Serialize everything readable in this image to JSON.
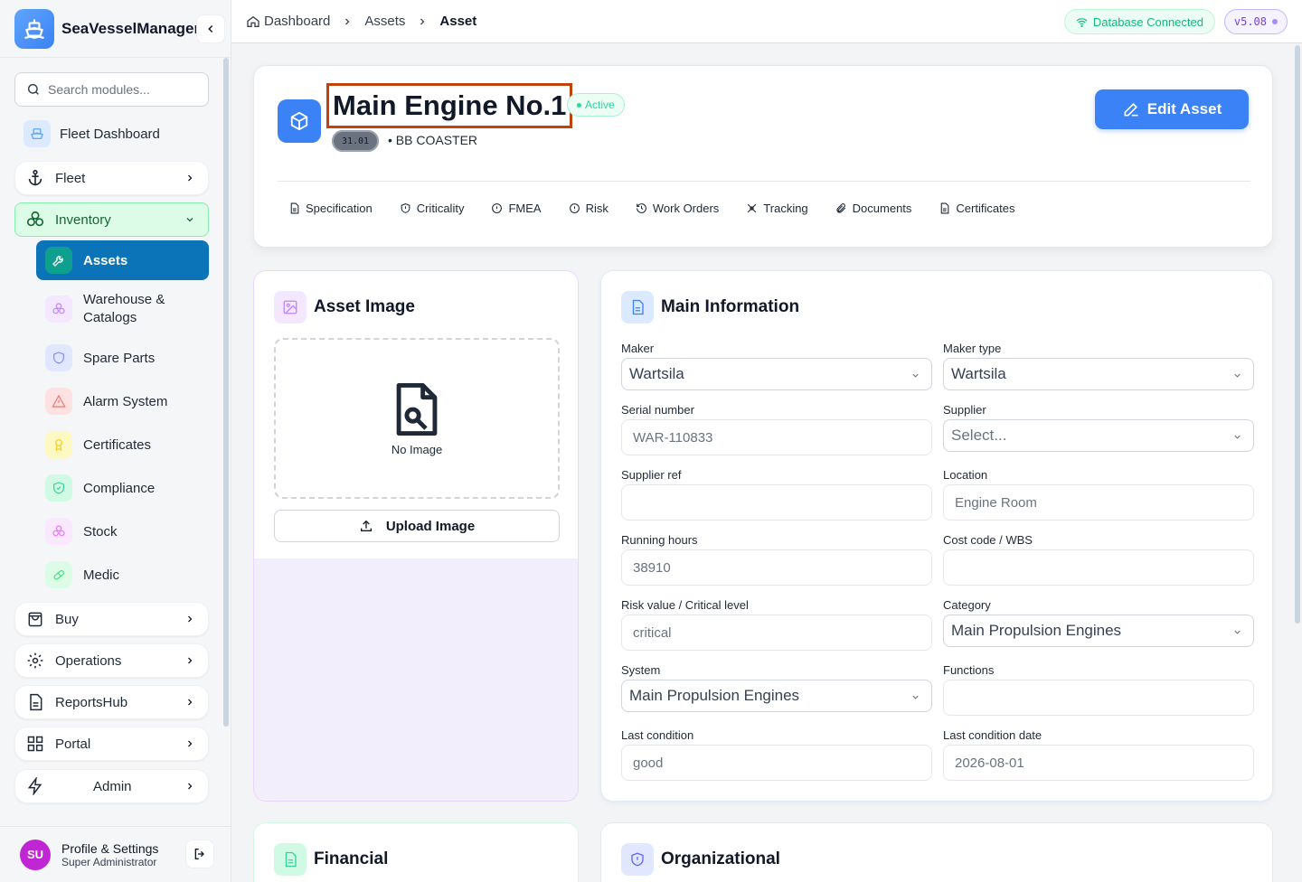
{
  "app": {
    "name": "SeaVesselManager",
    "search_placeholder": "Search modules..."
  },
  "sidebar": {
    "fleet_dashboard": "Fleet Dashboard",
    "fleet": "Fleet",
    "inventory": "Inventory",
    "inventory_items": [
      {
        "label": "Assets",
        "icon": "wrench-icon",
        "color": "#10b981"
      },
      {
        "label": "Warehouse & Catalogs",
        "icon": "boxes-icon",
        "color": "#c084fc"
      },
      {
        "label": "Spare Parts",
        "icon": "shield-icon",
        "color": "#818cf8"
      },
      {
        "label": "Alarm System",
        "icon": "warning-icon",
        "color": "#f87171"
      },
      {
        "label": "Certificates",
        "icon": "award-icon",
        "color": "#facc15"
      },
      {
        "label": "Compliance",
        "icon": "shield-check-icon",
        "color": "#34d399"
      },
      {
        "label": "Stock",
        "icon": "boxes-icon",
        "color": "#e879f9"
      },
      {
        "label": "Medic",
        "icon": "pill-icon",
        "color": "#4ade80"
      }
    ],
    "buy": "Buy",
    "operations": "Operations",
    "reports": "ReportsHub",
    "portal": "Portal",
    "admin": "Admin",
    "profile": {
      "initials": "SU",
      "name": "Profile & Settings",
      "role": "Super Administrator"
    }
  },
  "topbar": {
    "breadcrumb": [
      "Dashboard",
      "Assets",
      "Asset"
    ],
    "db_status": "Database Connected",
    "version": "v5.08"
  },
  "asset": {
    "title": "Main Engine No.1",
    "status": "Active",
    "code": "31.01",
    "vessel": "BB COASTER",
    "edit_label": "Edit Asset",
    "tabs": [
      "Specification",
      "Criticality",
      "FMEA",
      "Risk",
      "Work Orders",
      "Tracking",
      "Documents",
      "Certificates"
    ]
  },
  "image_card": {
    "title": "Asset Image",
    "no_image": "No Image",
    "upload": "Upload Image"
  },
  "main_info": {
    "title": "Main Information",
    "fields": {
      "maker": {
        "label": "Maker",
        "value": "Wartsila"
      },
      "maker_type": {
        "label": "Maker type",
        "value": "Wartsila"
      },
      "serial": {
        "label": "Serial number",
        "value": "WAR-110833"
      },
      "supplier": {
        "label": "Supplier",
        "value": "Select..."
      },
      "supplier_ref": {
        "label": "Supplier ref",
        "value": ""
      },
      "location": {
        "label": "Location",
        "value": "Engine Room"
      },
      "running_hours": {
        "label": "Running hours",
        "value": "38910"
      },
      "cost_code": {
        "label": "Cost code / WBS",
        "value": ""
      },
      "risk": {
        "label": "Risk value / Critical level",
        "value": "critical"
      },
      "category": {
        "label": "Category",
        "value": "Main Propulsion Engines"
      },
      "system": {
        "label": "System",
        "value": "Main Propulsion Engines"
      },
      "functions": {
        "label": "Functions",
        "value": ""
      },
      "last_condition": {
        "label": "Last condition",
        "value": "good"
      },
      "last_condition_date": {
        "label": "Last condition date",
        "value": "2026-08-01"
      }
    }
  },
  "financial": {
    "title": "Financial"
  },
  "organizational": {
    "title": "Organizational"
  }
}
